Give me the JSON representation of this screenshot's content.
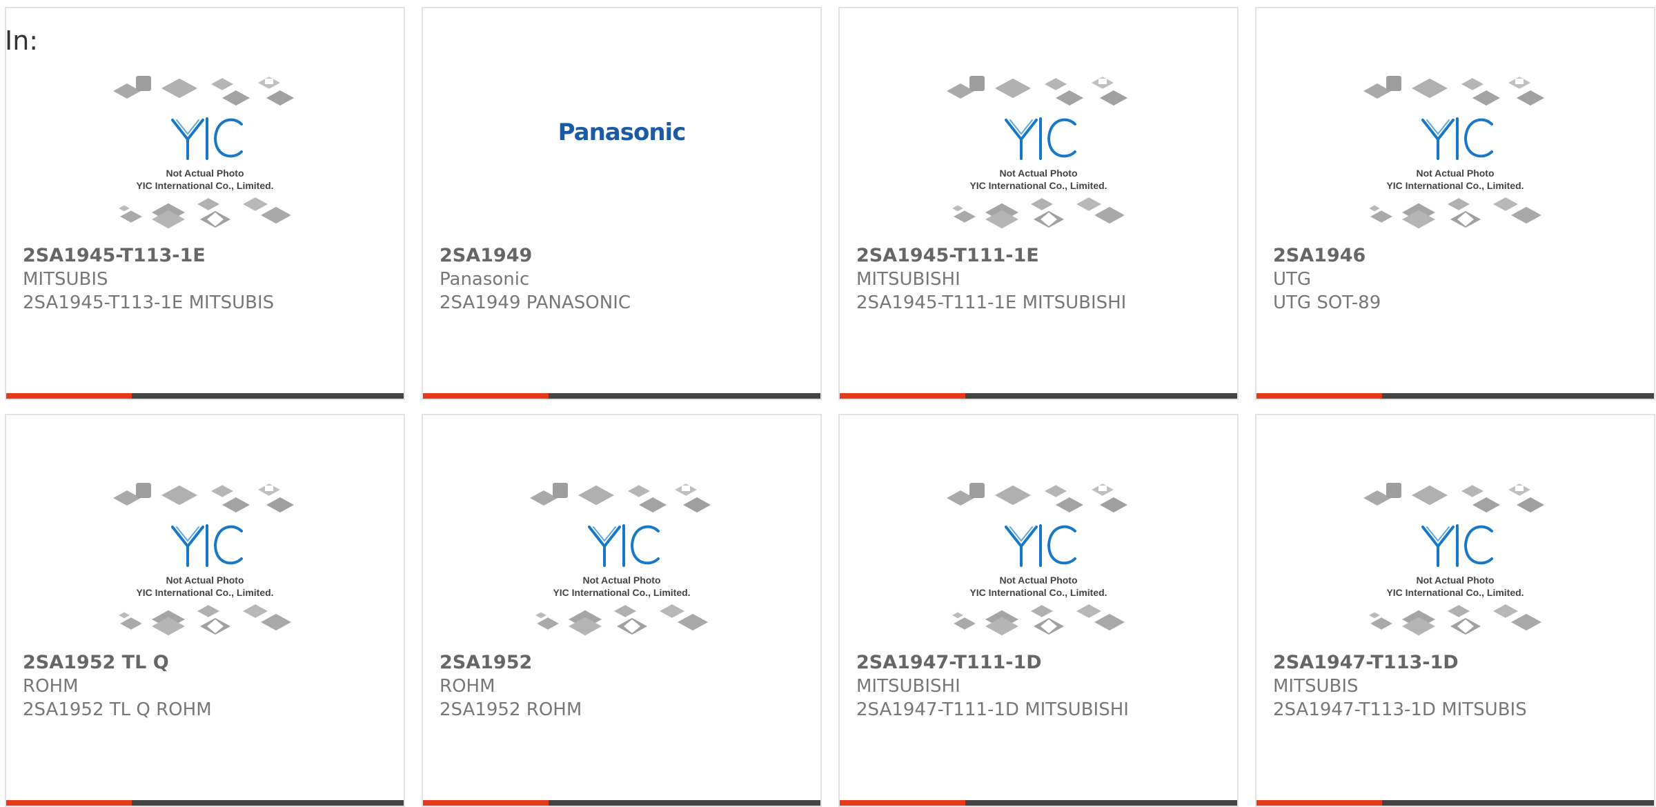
{
  "heading": "In:",
  "placeholder_text": {
    "line1": "Not Actual Photo",
    "line2": "YIC International Co., Limited.",
    "logo": "YIC"
  },
  "accent_color": "#e6381a",
  "bar_color": "#444444",
  "products": [
    {
      "part": "2SA1945-T113-1E",
      "manufacturer": "MITSUBIS",
      "description": "2SA1945-T113-1E MITSUBIS",
      "image": "placeholder"
    },
    {
      "part": "2SA1949",
      "manufacturer": "Panasonic",
      "description": "2SA1949 PANASONIC",
      "image": "panasonic",
      "logo_text": "Panasonic"
    },
    {
      "part": "2SA1945-T111-1E",
      "manufacturer": "MITSUBISHI",
      "description": "2SA1945-T111-1E MITSUBISHI",
      "image": "placeholder"
    },
    {
      "part": "2SA1946",
      "manufacturer": "UTG",
      "description": "UTG SOT-89",
      "image": "placeholder"
    },
    {
      "part": "2SA1952 TL Q",
      "manufacturer": "ROHM",
      "description": "2SA1952 TL Q ROHM",
      "image": "placeholder"
    },
    {
      "part": "2SA1952",
      "manufacturer": "ROHM",
      "description": "2SA1952 ROHM",
      "image": "placeholder"
    },
    {
      "part": "2SA1947-T111-1D",
      "manufacturer": "MITSUBISHI",
      "description": "2SA1947-T111-1D MITSUBISHI",
      "image": "placeholder"
    },
    {
      "part": "2SA1947-T113-1D",
      "manufacturer": "MITSUBIS",
      "description": "2SA1947-T113-1D MITSUBIS",
      "image": "placeholder"
    }
  ]
}
